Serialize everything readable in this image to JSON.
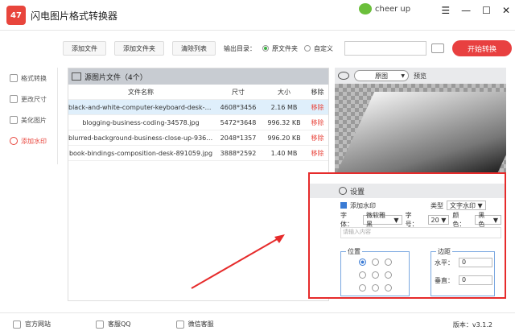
{
  "app": {
    "title": "闪电图片格式转换器",
    "logo_text": "47",
    "user_name": "cheer up",
    "window_buttons": [
      "☰",
      "—",
      "☐",
      "✕"
    ]
  },
  "toolbar": {
    "add_file": "添加文件",
    "add_folder": "添加文件夹",
    "clear_list": "清除列表",
    "output_label": "输出目录：",
    "option_source": "原文件夹",
    "option_custom": "自定义",
    "start": "开始转换"
  },
  "sidebar": {
    "items": [
      {
        "label": "格式转换"
      },
      {
        "label": "更改尺寸"
      },
      {
        "label": "美化图片"
      },
      {
        "label": "添加水印",
        "active": true
      }
    ]
  },
  "filelist": {
    "title": "源图片文件（4个）",
    "columns": [
      "文件名称",
      "尺寸",
      "大小",
      "移除"
    ],
    "rows": [
      {
        "name": "black-and-white-computer-keyboard-desk-209...",
        "size": "4608*3456",
        "filesize": "2.16 MB",
        "remove": "移除"
      },
      {
        "name": "blogging-business-coding-34578.jpg",
        "size": "5472*3648",
        "filesize": "996.32 KB",
        "remove": "移除"
      },
      {
        "name": "blurred-background-business-close-up-936137...",
        "size": "2048*1357",
        "filesize": "996.20 KB",
        "remove": "移除"
      },
      {
        "name": "book-bindings-composition-desk-891059.jpg",
        "size": "3888*2592",
        "filesize": "1.40 MB",
        "remove": "移除"
      }
    ]
  },
  "preview": {
    "mode": "原图",
    "label": "预览"
  },
  "settings": {
    "title": "设置",
    "add_watermark": "添加水印",
    "type_label": "类型",
    "type_value": "文字水印",
    "font_label": "字体：",
    "font_value": "微软雅黑",
    "size_label": "字号：",
    "size_value": "20",
    "color_label": "颜色：",
    "color_value": "黑色",
    "text_placeholder": "请输入内容",
    "position_label": "位置",
    "margin_label": "边距",
    "horizontal_label": "水平：",
    "horizontal_value": "0",
    "vertical_label": "垂直：",
    "vertical_value": "0"
  },
  "footer": {
    "website": "官方网站",
    "qq": "客服QQ",
    "wechat": "微信客服",
    "version": "版本：v3.1.2"
  },
  "colors": {
    "accent": "#e8453c",
    "highlight_box": "#e62b2b"
  }
}
